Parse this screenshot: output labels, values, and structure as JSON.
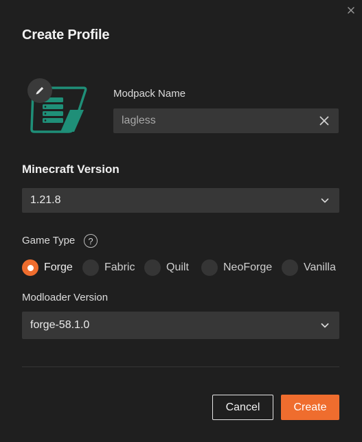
{
  "dialog": {
    "title": "Create Profile",
    "close_icon": "close-icon"
  },
  "modpack": {
    "label": "Modpack Name",
    "value": "lagless",
    "icon": "modpack-icon",
    "edit_icon": "pencil-icon",
    "clear_icon": "clear-icon"
  },
  "minecraft": {
    "section_title": "Minecraft Version",
    "selected": "1.21.8"
  },
  "game_type": {
    "label": "Game Type",
    "help_symbol": "?",
    "options": [
      {
        "label": "Forge",
        "selected": true
      },
      {
        "label": "Fabric",
        "selected": false
      },
      {
        "label": "Quilt",
        "selected": false
      },
      {
        "label": "NeoForge",
        "selected": false
      },
      {
        "label": "Vanilla",
        "selected": false
      }
    ]
  },
  "modloader": {
    "label": "Modloader Version",
    "selected": "forge-58.1.0"
  },
  "actions": {
    "cancel": "Cancel",
    "create": "Create"
  },
  "colors": {
    "accent": "#ef6d2e",
    "background": "#1f1f1f",
    "input": "#373737",
    "icon_teal": "#1f8f78"
  }
}
